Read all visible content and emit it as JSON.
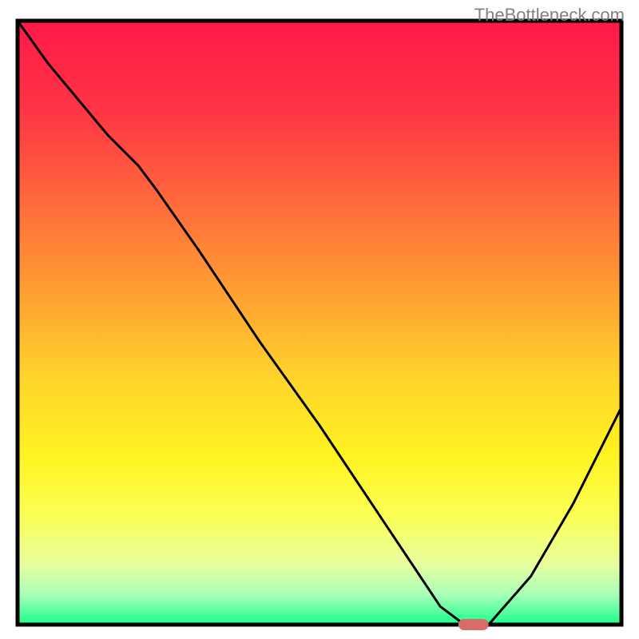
{
  "watermark": "TheBottleneck.com",
  "chart_data": {
    "type": "line",
    "title": "",
    "xlabel": "",
    "ylabel": "",
    "xlim": [
      0,
      100
    ],
    "ylim": [
      0,
      100
    ],
    "series": [
      {
        "name": "bottleneck-curve",
        "x": [
          0,
          5,
          10,
          15,
          20,
          23,
          30,
          40,
          50,
          60,
          66,
          70,
          74,
          78,
          85,
          92,
          100
        ],
        "y": [
          100,
          93,
          87,
          81,
          76,
          72,
          62,
          47,
          33,
          18,
          9,
          3,
          0,
          0,
          8,
          20,
          36
        ]
      }
    ],
    "minimum_marker": {
      "x_start": 73,
      "x_end": 78,
      "y": 0,
      "color": "#d96b6b"
    },
    "gradient_stops": [
      {
        "offset": 0,
        "color": "#ff1948"
      },
      {
        "offset": 15,
        "color": "#ff3545"
      },
      {
        "offset": 30,
        "color": "#ff6a3c"
      },
      {
        "offset": 45,
        "color": "#ffa033"
      },
      {
        "offset": 60,
        "color": "#ffd62a"
      },
      {
        "offset": 72,
        "color": "#fff321"
      },
      {
        "offset": 82,
        "color": "#fcff55"
      },
      {
        "offset": 90,
        "color": "#e8ffa0"
      },
      {
        "offset": 95,
        "color": "#a8ffb8"
      },
      {
        "offset": 100,
        "color": "#1cff8c"
      }
    ],
    "border_color": "#000000",
    "curve_color": "#000000"
  }
}
